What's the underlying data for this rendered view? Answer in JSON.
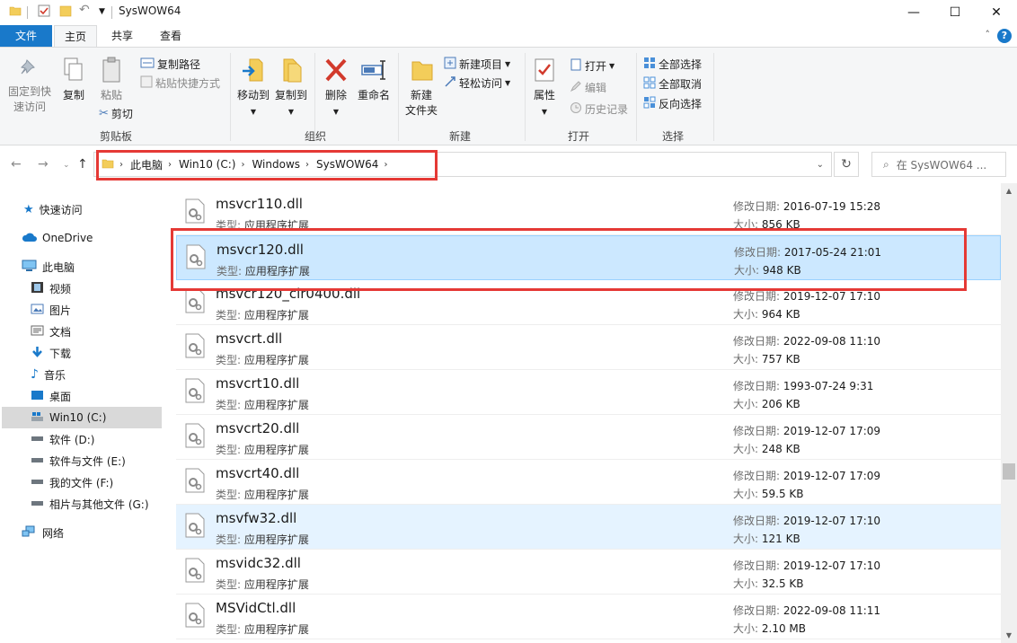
{
  "window": {
    "title": "SysWOW64",
    "minimize_glyph": "—",
    "maximize_glyph": "☐",
    "close_glyph": "✕"
  },
  "ribbon_tabs": {
    "file": "文件",
    "home": "主页",
    "share": "共享",
    "view": "查看",
    "help": "?"
  },
  "ribbon": {
    "clipboard": {
      "pin": "固定到快速访问",
      "pin_line1": "固定到快",
      "pin_line2": "速访问",
      "copy": "复制",
      "paste": "粘贴",
      "copy_path": "复制路径",
      "paste_shortcut": "粘贴快捷方式",
      "cut": "剪切",
      "label": "剪贴板"
    },
    "organize": {
      "move_to": "移动到",
      "copy_to": "复制到",
      "delete": "删除",
      "rename": "重命名",
      "label": "组织"
    },
    "new": {
      "new_folder_line1": "新建",
      "new_folder_line2": "文件夹",
      "new_item": "新建项目",
      "easy_access": "轻松访问",
      "label": "新建"
    },
    "open": {
      "properties": "属性",
      "open": "打开",
      "edit": "编辑",
      "history": "历史记录",
      "label": "打开"
    },
    "select": {
      "select_all": "全部选择",
      "select_none": "全部取消",
      "invert": "反向选择",
      "label": "选择"
    }
  },
  "address": {
    "crumbs": [
      "此电脑",
      "Win10 (C:)",
      "Windows",
      "SysWOW64"
    ],
    "search_placeholder": "在 SysWOW64 ..."
  },
  "navpane": {
    "quick_access": "快速访问",
    "onedrive": "OneDrive",
    "this_pc": "此电脑",
    "videos": "视频",
    "pictures": "图片",
    "documents": "文档",
    "downloads": "下载",
    "music": "音乐",
    "desktop": "桌面",
    "drive_c": "Win10 (C:)",
    "drive_d": "软件 (D:)",
    "drive_e": "软件与文件 (E:)",
    "drive_f": "我的文件 (F:)",
    "drive_g": "相片与其他文件 (G:)",
    "network": "网络"
  },
  "labels": {
    "type": "类型:",
    "modified": "修改日期:",
    "size": "大小:"
  },
  "files": [
    {
      "name": "msvcr110.dll",
      "type": "应用程序扩展",
      "date": "2016-07-19 15:28",
      "size": "856 KB"
    },
    {
      "name": "msvcr120.dll",
      "type": "应用程序扩展",
      "date": "2017-05-24 21:01",
      "size": "948 KB"
    },
    {
      "name": "msvcr120_clr0400.dll",
      "type": "应用程序扩展",
      "date": "2019-12-07 17:10",
      "size": "964 KB"
    },
    {
      "name": "msvcrt.dll",
      "type": "应用程序扩展",
      "date": "2022-09-08 11:10",
      "size": "757 KB"
    },
    {
      "name": "msvcrt10.dll",
      "type": "应用程序扩展",
      "date": "1993-07-24 9:31",
      "size": "206 KB"
    },
    {
      "name": "msvcrt20.dll",
      "type": "应用程序扩展",
      "date": "2019-12-07 17:09",
      "size": "248 KB"
    },
    {
      "name": "msvcrt40.dll",
      "type": "应用程序扩展",
      "date": "2019-12-07 17:09",
      "size": "59.5 KB"
    },
    {
      "name": "msvfw32.dll",
      "type": "应用程序扩展",
      "date": "2019-12-07 17:10",
      "size": "121 KB"
    },
    {
      "name": "msvidc32.dll",
      "type": "应用程序扩展",
      "date": "2019-12-07 17:10",
      "size": "32.5 KB"
    },
    {
      "name": "MSVidCtl.dll",
      "type": "应用程序扩展",
      "date": "2022-09-08 11:11",
      "size": "2.10 MB"
    }
  ],
  "colors": {
    "accent": "#1979ca",
    "selection": "#cce8ff",
    "highlight_box": "#e53935"
  }
}
